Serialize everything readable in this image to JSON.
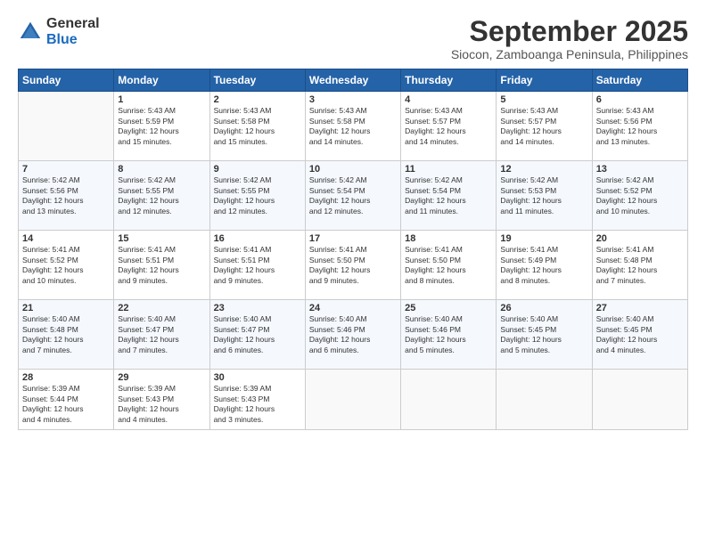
{
  "logo": {
    "general": "General",
    "blue": "Blue"
  },
  "header": {
    "month_title": "September 2025",
    "subtitle": "Siocon, Zamboanga Peninsula, Philippines"
  },
  "weekdays": [
    "Sunday",
    "Monday",
    "Tuesday",
    "Wednesday",
    "Thursday",
    "Friday",
    "Saturday"
  ],
  "weeks": [
    [
      {
        "day": "",
        "info": ""
      },
      {
        "day": "1",
        "info": "Sunrise: 5:43 AM\nSunset: 5:59 PM\nDaylight: 12 hours\nand 15 minutes."
      },
      {
        "day": "2",
        "info": "Sunrise: 5:43 AM\nSunset: 5:58 PM\nDaylight: 12 hours\nand 15 minutes."
      },
      {
        "day": "3",
        "info": "Sunrise: 5:43 AM\nSunset: 5:58 PM\nDaylight: 12 hours\nand 14 minutes."
      },
      {
        "day": "4",
        "info": "Sunrise: 5:43 AM\nSunset: 5:57 PM\nDaylight: 12 hours\nand 14 minutes."
      },
      {
        "day": "5",
        "info": "Sunrise: 5:43 AM\nSunset: 5:57 PM\nDaylight: 12 hours\nand 14 minutes."
      },
      {
        "day": "6",
        "info": "Sunrise: 5:43 AM\nSunset: 5:56 PM\nDaylight: 12 hours\nand 13 minutes."
      }
    ],
    [
      {
        "day": "7",
        "info": "Sunrise: 5:42 AM\nSunset: 5:56 PM\nDaylight: 12 hours\nand 13 minutes."
      },
      {
        "day": "8",
        "info": "Sunrise: 5:42 AM\nSunset: 5:55 PM\nDaylight: 12 hours\nand 12 minutes."
      },
      {
        "day": "9",
        "info": "Sunrise: 5:42 AM\nSunset: 5:55 PM\nDaylight: 12 hours\nand 12 minutes."
      },
      {
        "day": "10",
        "info": "Sunrise: 5:42 AM\nSunset: 5:54 PM\nDaylight: 12 hours\nand 12 minutes."
      },
      {
        "day": "11",
        "info": "Sunrise: 5:42 AM\nSunset: 5:54 PM\nDaylight: 12 hours\nand 11 minutes."
      },
      {
        "day": "12",
        "info": "Sunrise: 5:42 AM\nSunset: 5:53 PM\nDaylight: 12 hours\nand 11 minutes."
      },
      {
        "day": "13",
        "info": "Sunrise: 5:42 AM\nSunset: 5:52 PM\nDaylight: 12 hours\nand 10 minutes."
      }
    ],
    [
      {
        "day": "14",
        "info": "Sunrise: 5:41 AM\nSunset: 5:52 PM\nDaylight: 12 hours\nand 10 minutes."
      },
      {
        "day": "15",
        "info": "Sunrise: 5:41 AM\nSunset: 5:51 PM\nDaylight: 12 hours\nand 9 minutes."
      },
      {
        "day": "16",
        "info": "Sunrise: 5:41 AM\nSunset: 5:51 PM\nDaylight: 12 hours\nand 9 minutes."
      },
      {
        "day": "17",
        "info": "Sunrise: 5:41 AM\nSunset: 5:50 PM\nDaylight: 12 hours\nand 9 minutes."
      },
      {
        "day": "18",
        "info": "Sunrise: 5:41 AM\nSunset: 5:50 PM\nDaylight: 12 hours\nand 8 minutes."
      },
      {
        "day": "19",
        "info": "Sunrise: 5:41 AM\nSunset: 5:49 PM\nDaylight: 12 hours\nand 8 minutes."
      },
      {
        "day": "20",
        "info": "Sunrise: 5:41 AM\nSunset: 5:48 PM\nDaylight: 12 hours\nand 7 minutes."
      }
    ],
    [
      {
        "day": "21",
        "info": "Sunrise: 5:40 AM\nSunset: 5:48 PM\nDaylight: 12 hours\nand 7 minutes."
      },
      {
        "day": "22",
        "info": "Sunrise: 5:40 AM\nSunset: 5:47 PM\nDaylight: 12 hours\nand 7 minutes."
      },
      {
        "day": "23",
        "info": "Sunrise: 5:40 AM\nSunset: 5:47 PM\nDaylight: 12 hours\nand 6 minutes."
      },
      {
        "day": "24",
        "info": "Sunrise: 5:40 AM\nSunset: 5:46 PM\nDaylight: 12 hours\nand 6 minutes."
      },
      {
        "day": "25",
        "info": "Sunrise: 5:40 AM\nSunset: 5:46 PM\nDaylight: 12 hours\nand 5 minutes."
      },
      {
        "day": "26",
        "info": "Sunrise: 5:40 AM\nSunset: 5:45 PM\nDaylight: 12 hours\nand 5 minutes."
      },
      {
        "day": "27",
        "info": "Sunrise: 5:40 AM\nSunset: 5:45 PM\nDaylight: 12 hours\nand 4 minutes."
      }
    ],
    [
      {
        "day": "28",
        "info": "Sunrise: 5:39 AM\nSunset: 5:44 PM\nDaylight: 12 hours\nand 4 minutes."
      },
      {
        "day": "29",
        "info": "Sunrise: 5:39 AM\nSunset: 5:43 PM\nDaylight: 12 hours\nand 4 minutes."
      },
      {
        "day": "30",
        "info": "Sunrise: 5:39 AM\nSunset: 5:43 PM\nDaylight: 12 hours\nand 3 minutes."
      },
      {
        "day": "",
        "info": ""
      },
      {
        "day": "",
        "info": ""
      },
      {
        "day": "",
        "info": ""
      },
      {
        "day": "",
        "info": ""
      }
    ]
  ]
}
